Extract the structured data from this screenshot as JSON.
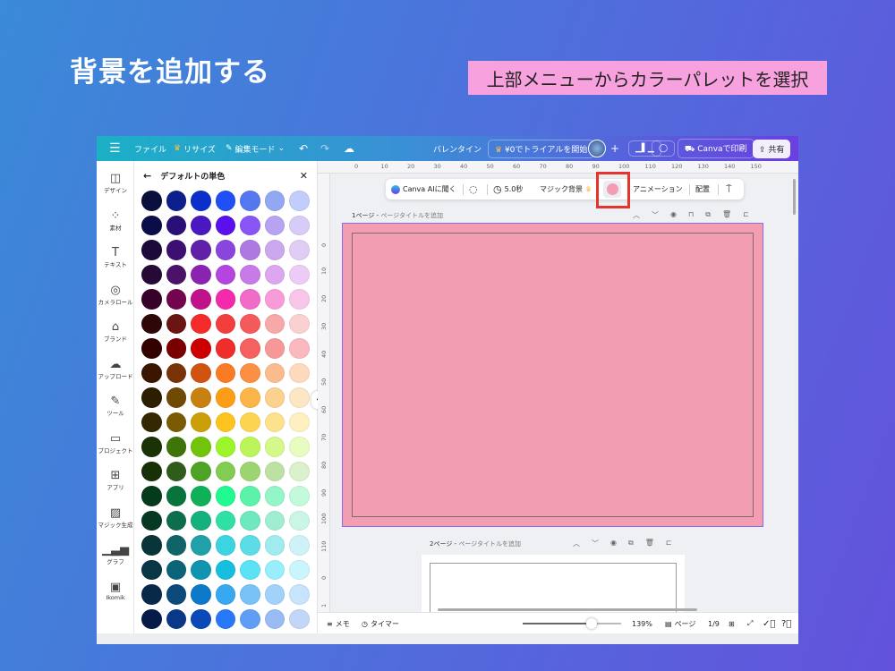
{
  "slide": {
    "title": "背景を追加する",
    "note": "上部メニューからカラーパレットを選択"
  },
  "topbar": {
    "menu_icon": "hamburger-icon",
    "file": "ファイル",
    "resize": "リサイズ",
    "edit_mode": "編集モード",
    "doc_title": "バレンタイン",
    "trial": "¥0でトライアルを開始",
    "add": "+",
    "print": "Canvaで印刷",
    "share": "共有"
  },
  "rail": {
    "items": [
      {
        "label": "デザイン",
        "icon": "layout-icon",
        "glyph": "◫"
      },
      {
        "label": "素材",
        "icon": "shapes-icon",
        "glyph": "⁘"
      },
      {
        "label": "テキスト",
        "icon": "text-icon",
        "glyph": "T"
      },
      {
        "label": "カメラロール",
        "icon": "camera-icon",
        "glyph": "◎"
      },
      {
        "label": "ブランド",
        "icon": "brand-icon",
        "glyph": "⌂"
      },
      {
        "label": "アップロード",
        "icon": "cloud-upload-icon",
        "glyph": "☁"
      },
      {
        "label": "ツール",
        "icon": "pen-tool-icon",
        "glyph": "✎"
      },
      {
        "label": "プロジェクト",
        "icon": "folder-icon",
        "glyph": "▭"
      },
      {
        "label": "アプリ",
        "icon": "apps-icon",
        "glyph": "⊞"
      },
      {
        "label": "マジック生成",
        "icon": "magic-image-icon",
        "glyph": "▨"
      },
      {
        "label": "グラフ",
        "icon": "chart-icon",
        "glyph": "▁▃▅"
      },
      {
        "label": "Ikomik",
        "icon": "ikomik-app-icon",
        "glyph": "▣"
      }
    ]
  },
  "panel": {
    "title": "デフォルトの単色",
    "back": "←",
    "close": "✕",
    "colors": [
      [
        "#0a0f3c",
        "#0d1f8a",
        "#0c2fcc",
        "#1f4ff5",
        "#5578f0",
        "#93a8f2",
        "#c3cdfa"
      ],
      [
        "#0a0d48",
        "#2a0f78",
        "#4a18c0",
        "#5a10ee",
        "#8a55f5",
        "#b8a3f2",
        "#d7cbf8"
      ],
      [
        "#1c0a3a",
        "#3c1070",
        "#6020a8",
        "#8a45dc",
        "#ad7ae0",
        "#cba8ee",
        "#e0cdf4"
      ],
      [
        "#260a35",
        "#4a1268",
        "#8a24b0",
        "#b545e0",
        "#c67be6",
        "#dca6f0",
        "#ecccf6"
      ],
      [
        "#36022a",
        "#73054e",
        "#c0128a",
        "#f529ac",
        "#f06cc8",
        "#f79cd8",
        "#f8c6e8"
      ],
      [
        "#2e0808",
        "#6a1414",
        "#f52b2b",
        "#f33e3e",
        "#f55a5a",
        "#f7a8a8",
        "#fbd0d0"
      ],
      [
        "#330000",
        "#7a0000",
        "#cc0000",
        "#f02d2d",
        "#f56060",
        "#f79898",
        "#fbb8bf"
      ],
      [
        "#3a1600",
        "#7a3208",
        "#d05410",
        "#fb7a24",
        "#fb9044",
        "#fbbb8c",
        "#fddabe"
      ],
      [
        "#2d1e02",
        "#704a04",
        "#c88010",
        "#fc9d18",
        "#fcb548",
        "#fcd08e",
        "#fde6c4"
      ],
      [
        "#332802",
        "#7a5a04",
        "#cc9e08",
        "#fdc420",
        "#fdd452",
        "#fde28e",
        "#fef0c0"
      ],
      [
        "#1a3206",
        "#3e7408",
        "#72c40a",
        "#9cf52a",
        "#bcf55a",
        "#d4f88a",
        "#e8fcc0"
      ],
      [
        "#183008",
        "#2f5c1a",
        "#4ea326",
        "#82cc52",
        "#9cd472",
        "#bde1a2",
        "#dbf0cc"
      ],
      [
        "#063a1c",
        "#08743c",
        "#10b058",
        "#20fa90",
        "#5cf2a8",
        "#94f6c8",
        "#c4fadc"
      ],
      [
        "#063824",
        "#0c6e4c",
        "#16b07e",
        "#2ee0a4",
        "#6ee8be",
        "#a0eed2",
        "#cbf6e6"
      ],
      [
        "#08343a",
        "#106468",
        "#20a0a8",
        "#3cd4e0",
        "#5cdce6",
        "#a0eaf0",
        "#cef2f6"
      ],
      [
        "#083644",
        "#0c6478",
        "#1094b0",
        "#18bee0",
        "#5ce2f6",
        "#98eefa",
        "#c8f6fc"
      ],
      [
        "#082a48",
        "#0c4a7c",
        "#0c7ac8",
        "#38a8f0",
        "#78c2f8",
        "#a2d2fa",
        "#c8e4fc"
      ],
      [
        "#061c48",
        "#0a3888",
        "#0a4ab8",
        "#2878f8",
        "#609ef6",
        "#9abcf4",
        "#c4d6f8"
      ]
    ]
  },
  "ruler": {
    "h": [
      "0",
      "10",
      "20",
      "30",
      "40",
      "50",
      "60",
      "70",
      "80",
      "90",
      "100",
      "110",
      "120",
      "130",
      "140",
      "150"
    ],
    "v": [
      "0",
      "10",
      "20",
      "30",
      "40",
      "50",
      "60",
      "70",
      "80",
      "90",
      "100",
      "110",
      "0",
      "1"
    ]
  },
  "context": {
    "ai": "Canva AIに聞く",
    "duration": "5.0秒",
    "magic_bg": "マジック背景",
    "animation": "アニメーション",
    "position": "配置",
    "bg_color": "#f29db2"
  },
  "pages": [
    {
      "label": "1ページ",
      "dash": " - ",
      "title_placeholder": "ページタイトルを追加"
    },
    {
      "label": "2ページ",
      "dash": " - ",
      "title_placeholder": "ページタイトルを追加"
    }
  ],
  "bottom": {
    "notes": "メモ",
    "timer": "タイマー",
    "zoom": "139%",
    "zoom_level": 0.7,
    "pages": "ページ",
    "page_count": "1/9"
  }
}
